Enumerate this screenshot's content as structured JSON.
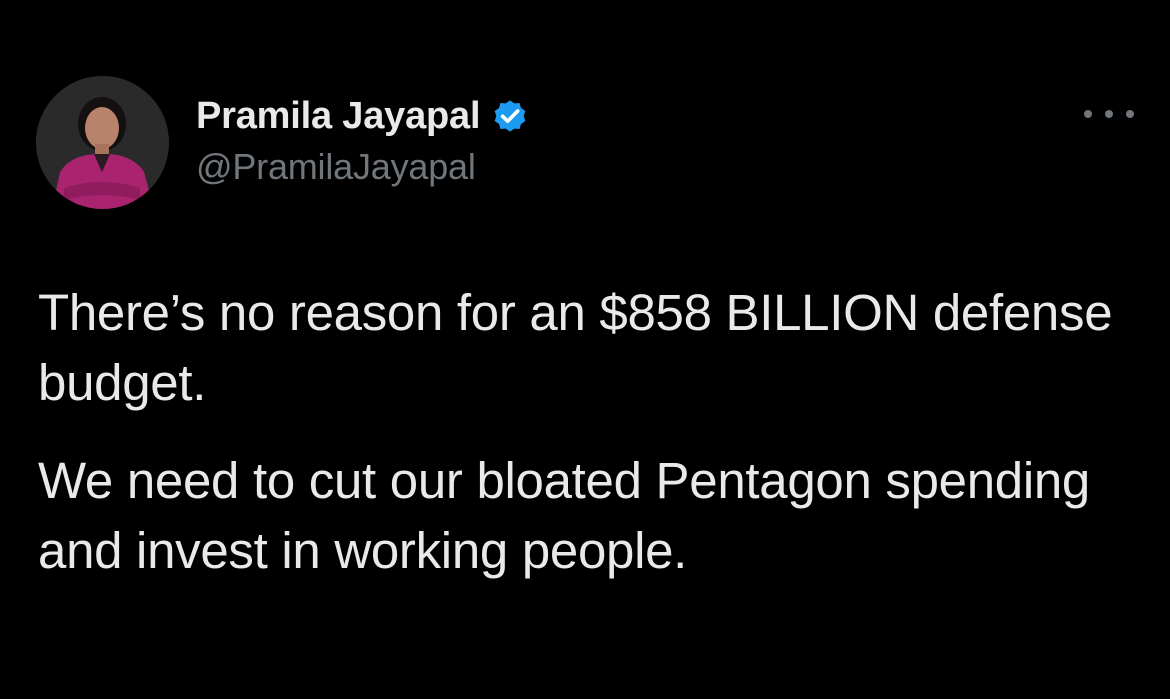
{
  "colors": {
    "background": "#000000",
    "primary_text": "#e7e9ea",
    "secondary_text": "#71767b",
    "verified_badge": "#1d9bf0"
  },
  "author": {
    "display_name": "Pramila Jayapal",
    "handle": "@PramilaJayapal",
    "verified": true,
    "verified_icon": "verified-badge-icon",
    "avatar_icon": "profile-photo"
  },
  "menu": {
    "icon": "more-options-icon"
  },
  "tweet": {
    "paragraphs": [
      "There’s no reason for an $858 BILLION defense budget.",
      "We need to cut our bloated Pentagon spending and invest in working people."
    ]
  }
}
